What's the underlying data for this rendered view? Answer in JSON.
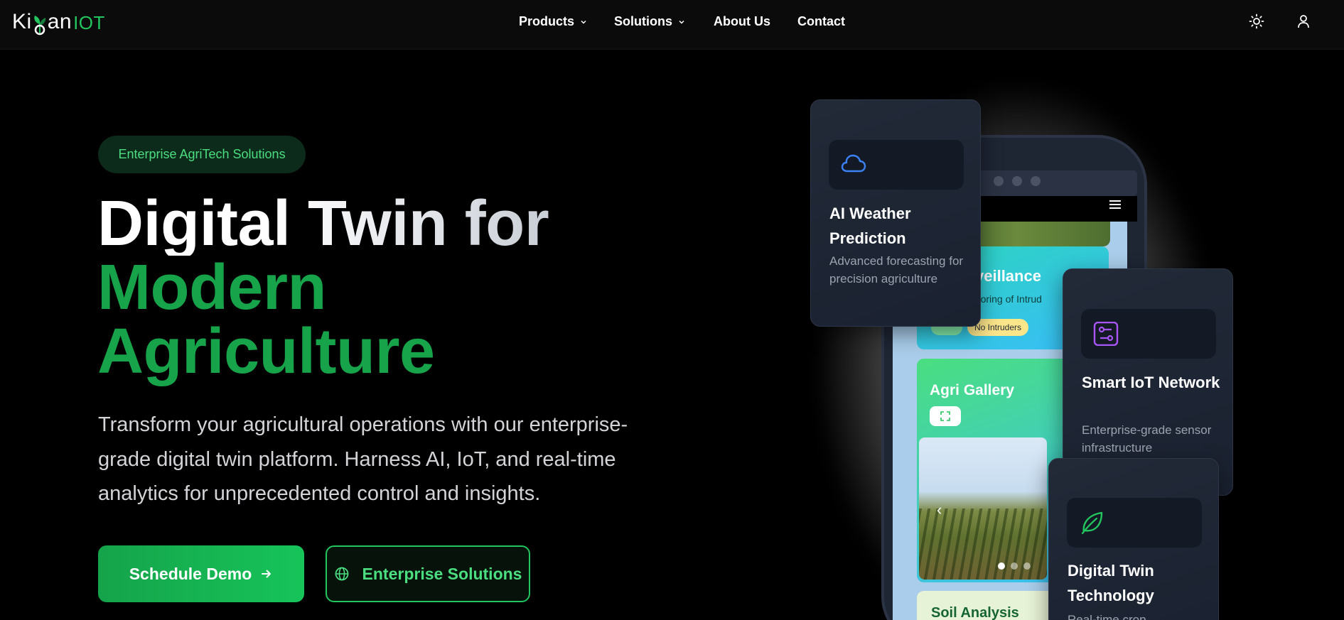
{
  "nav": {
    "logo_main": "Ki",
    "logo_mid": "an",
    "logo_suffix": "IOT",
    "links": [
      {
        "label": "Products",
        "has_dropdown": true
      },
      {
        "label": "Solutions",
        "has_dropdown": true
      },
      {
        "label": "About Us",
        "has_dropdown": false
      },
      {
        "label": "Contact",
        "has_dropdown": false
      }
    ],
    "icons": [
      "sun-icon",
      "user-icon"
    ]
  },
  "hero": {
    "badge": "Enterprise AgriTech Solutions",
    "title_line1": "Digital Twin for",
    "title_line2": "Modern",
    "title_line3": "Agriculture",
    "description": "Transform your agricultural operations with our enterprise-grade digital twin platform. Harness AI, IoT, and real-time analytics for unprecedented control and insights.",
    "primary_cta": "Schedule Demo",
    "secondary_cta": "Enterprise Solutions"
  },
  "phone": {
    "surveillance_title": "urveillance",
    "surveillance_sub": "onitoring of Intrud",
    "status_pill": "No Intruders",
    "gallery_title": "Agri Gallery",
    "soil_title": "Soil Analysis",
    "prev_arrow": "‹"
  },
  "features": [
    {
      "title": "AI Weather Prediction",
      "description": "Advanced forecasting for precision agriculture",
      "icon": "cloud-icon",
      "icon_color": "#3b82f6"
    },
    {
      "title": "Smart IoT Network",
      "description": "Enterprise-grade sensor infrastructure",
      "icon": "circuit-icon",
      "icon_color": "#a855f7"
    },
    {
      "title": "Digital Twin Technology",
      "description": "Real-time crop",
      "icon": "leaf-icon",
      "icon_color": "#22c55e"
    }
  ],
  "colors": {
    "brand_green": "#16a34a",
    "accent_green": "#4ade80",
    "background": "#000000",
    "card": "#1e2533"
  }
}
